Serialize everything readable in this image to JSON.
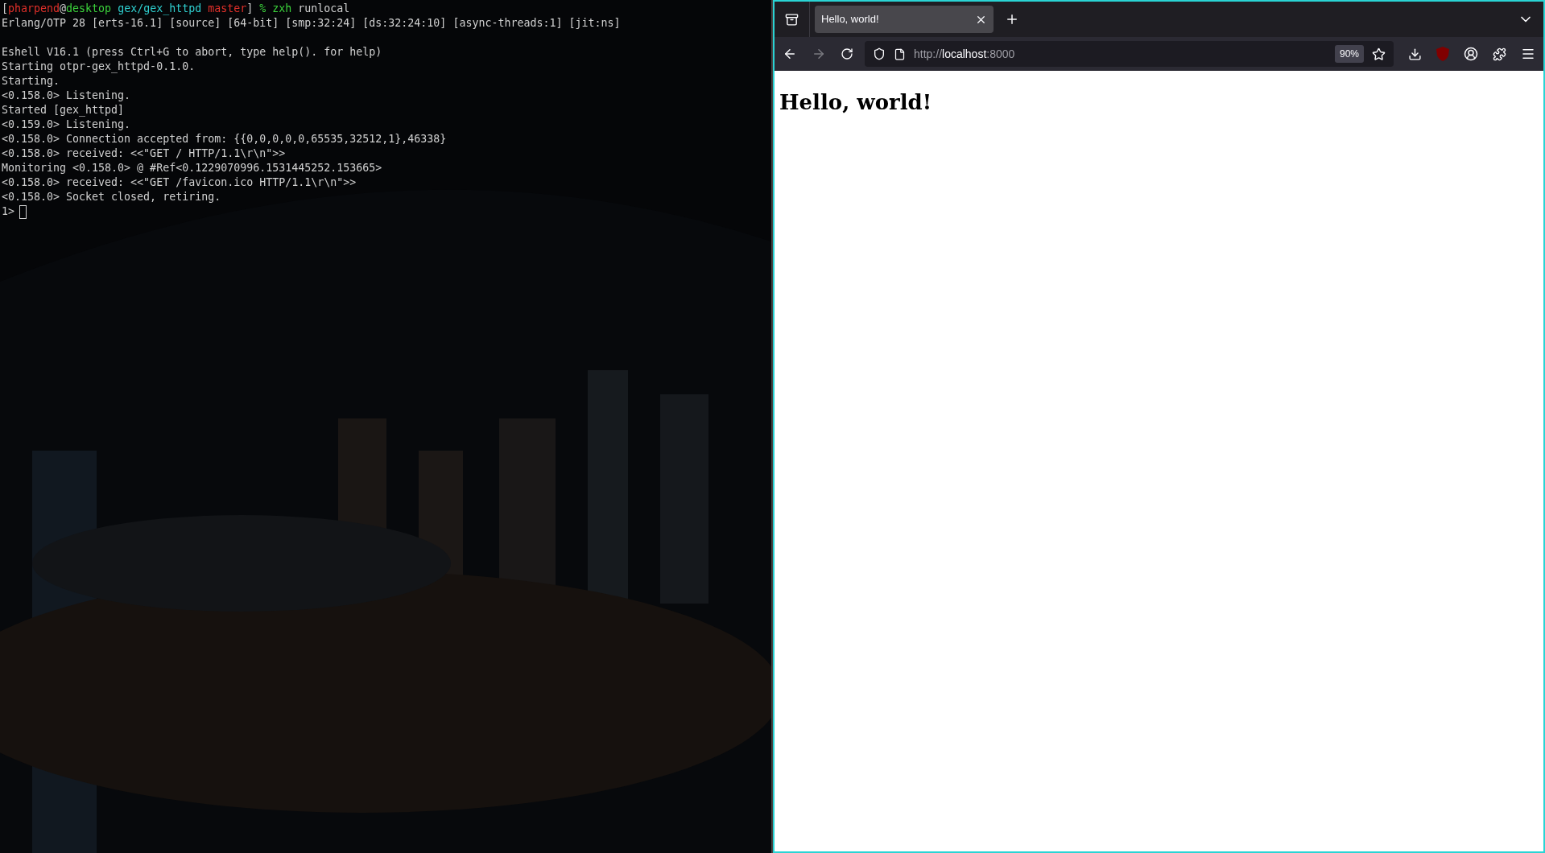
{
  "terminal": {
    "prompt": [
      {
        "text": "[",
        "color": "#d0d0d0"
      },
      {
        "text": "pharpend",
        "color": "#e0302a"
      },
      {
        "text": "@",
        "color": "#d0d0d0"
      },
      {
        "text": "desktop",
        "color": "#3bd13b"
      },
      {
        "text": " gex/gex_httpd",
        "color": "#2fd0d0"
      },
      {
        "text": " master",
        "color": "#e0302a"
      },
      {
        "text": "]",
        "color": "#d0d0d0"
      },
      {
        "text": " % zxh",
        "color": "#3bd13b"
      },
      {
        "text": " runlocal",
        "color": "#d0d0d0"
      }
    ],
    "blocks": [
      [
        "Erlang/OTP 28 [erts-16.1] [source] [64-bit] [smp:32:24] [ds:32:24:10] [async-threads:1] [jit:ns]"
      ],
      [
        "Eshell V16.1 (press Ctrl+G to abort, type help(). for help)",
        "Starting otpr-gex_httpd-0.1.0.",
        "Starting.",
        "<0.158.0> Listening.",
        "Started [gex_httpd]",
        "<0.159.0> Listening.",
        "<0.158.0> Connection accepted from: {{0,0,0,0,0,65535,32512,1},46338}",
        "<0.158.0> received: <<\"GET / HTTP/1.1\\r\\n\">>",
        "Monitoring <0.158.0> @ #Ref<0.1229070996.1531445252.153665>",
        "<0.158.0> received: <<\"GET /favicon.ico HTTP/1.1\\r\\n\">>",
        "<0.158.0> Socket closed, retiring."
      ]
    ],
    "input_prompt": "1>"
  },
  "browser": {
    "tabs": [
      {
        "title": "Hello, world!",
        "selected": true
      }
    ],
    "url": [
      {
        "text": "http://",
        "kind": "dim"
      },
      {
        "text": "localhost",
        "kind": "host"
      },
      {
        "text": ":8000",
        "kind": "dim"
      }
    ],
    "zoom": "90%",
    "back_disabled": false,
    "forward_disabled": true,
    "page": {
      "heading": "Hello, world!"
    }
  }
}
